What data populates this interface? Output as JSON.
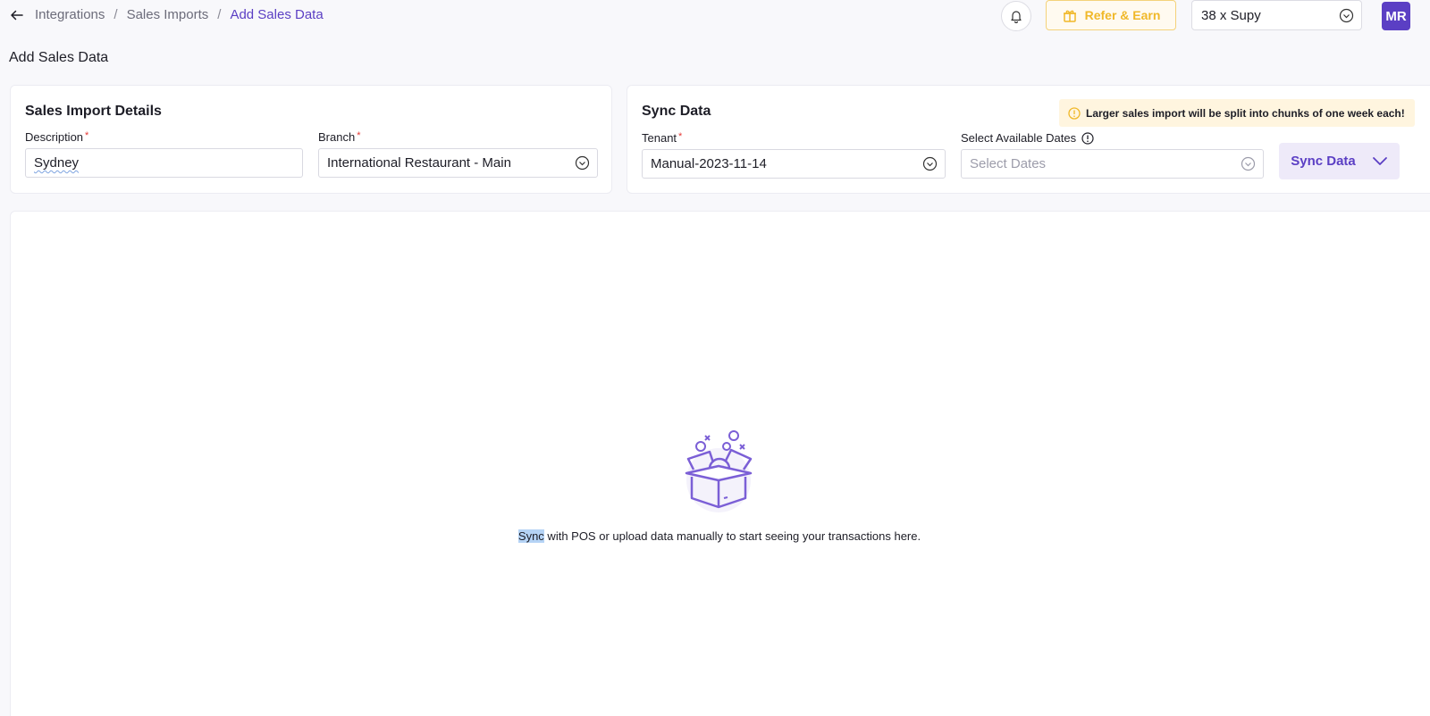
{
  "breadcrumb": {
    "items": [
      "Integrations",
      "Sales Imports",
      "Add Sales Data"
    ],
    "separator": "/"
  },
  "header": {
    "refer_label": "Refer & Earn",
    "org_selected": "38 x Supy",
    "avatar_initials": "MR"
  },
  "page": {
    "title": "Add Sales Data"
  },
  "sales_import": {
    "title": "Sales Import Details",
    "description_label": "Description",
    "description_value": "Sydney",
    "branch_label": "Branch",
    "branch_value": "International Restaurant - Main",
    "required_mark": "*"
  },
  "sync": {
    "title": "Sync Data",
    "warning": "Larger sales import will be split into chunks of one week each!",
    "tenant_label": "Tenant",
    "tenant_value": "Manual-2023-11-14",
    "dates_label": "Select Available Dates",
    "dates_placeholder": "Select Dates",
    "button_label": "Sync Data"
  },
  "empty_state": {
    "highlighted_word": "Sync",
    "message_rest": " with POS or upload data manually to start seeing your transactions here."
  },
  "colors": {
    "accent": "#5b3fc4",
    "refer": "#f0b829",
    "warning_bg": "#fff5df",
    "required": "#e53935"
  }
}
